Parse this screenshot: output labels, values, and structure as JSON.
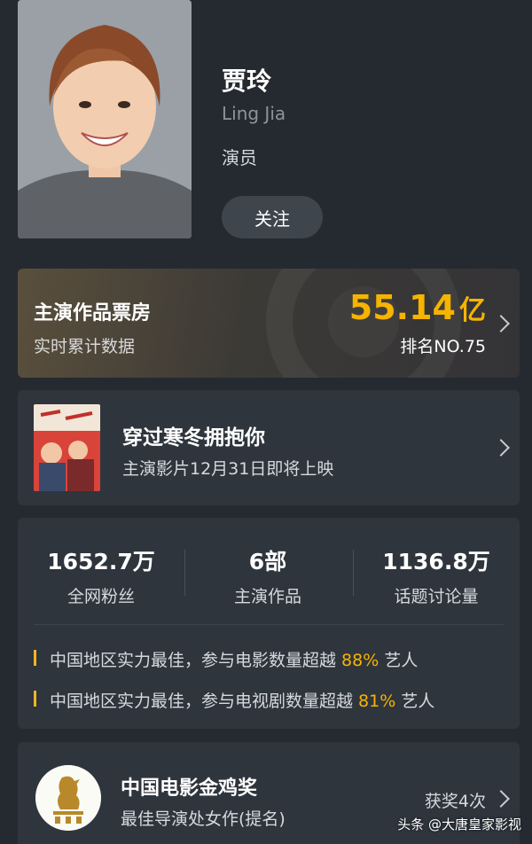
{
  "profile": {
    "name": "贾玲",
    "name_en": "Ling Jia",
    "role": "演员",
    "follow_label": "关注"
  },
  "box_office": {
    "title": "主演作品票房",
    "subtitle": "实时累计数据",
    "value": "55.14",
    "unit": "亿",
    "rank": "排名NO.75"
  },
  "upcoming_movie": {
    "title": "穿过寒冬拥抱你",
    "subtitle": "主演影片12月31日即将上映"
  },
  "stats": {
    "items": [
      {
        "value": "1652.7万",
        "label": "全网粉丝"
      },
      {
        "value": "6部",
        "label": "主演作品"
      },
      {
        "value": "1136.8万",
        "label": "话题讨论量"
      }
    ],
    "highlights": [
      {
        "prefix": "中国地区实力最佳，参与电影数量超越 ",
        "percent": "88%",
        "suffix": " 艺人"
      },
      {
        "prefix": "中国地区实力最佳，参与电视剧数量超越 ",
        "percent": "81%",
        "suffix": " 艺人"
      }
    ]
  },
  "award": {
    "title": "中国电影金鸡奖",
    "subtitle": "最佳导演处女作(提名)",
    "count": "获奖4次"
  },
  "watermark": "头条 @大唐皇家影视",
  "colors": {
    "background": "#252a31",
    "card": "#2f353d",
    "accent": "#f6b400"
  }
}
